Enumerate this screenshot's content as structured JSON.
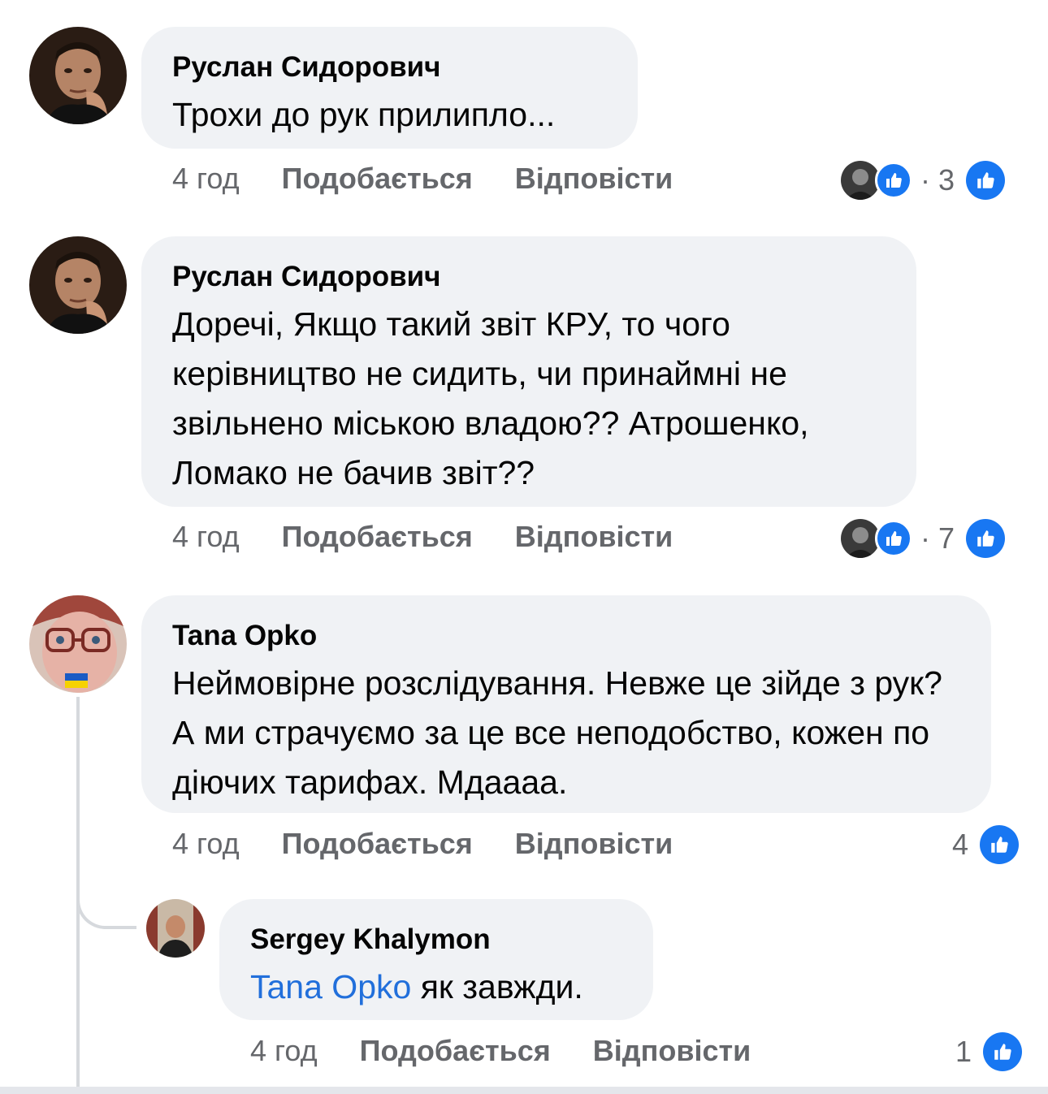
{
  "colors": {
    "bubble_bg": "#f0f2f5",
    "meta_text": "#65676b",
    "like_blue": "#1877f2",
    "mention_blue": "#216fdb"
  },
  "comments": [
    {
      "author": "Руслан Сидорович",
      "text": "Трохи до рук прилипло...",
      "time": "4 год",
      "like_label": "Подобається",
      "reply_label": "Відповісти",
      "reaction_separator": "·",
      "reaction_count": "3",
      "reaction_icons": [
        "reactor-avatar",
        "like-icon"
      ]
    },
    {
      "author": "Руслан Сидорович",
      "text": "Доречі, Якщо такий звіт КРУ, то чого керівництво не сидить, чи принаймні не звільнено міською владою?? Атрошенко, Ломако не бачив звіт??",
      "time": "4 год",
      "like_label": "Подобається",
      "reply_label": "Відповісти",
      "reaction_separator": "·",
      "reaction_count": "7",
      "reaction_icons": [
        "reactor-avatar",
        "like-icon"
      ]
    },
    {
      "author": "Tana  Opko",
      "text": "Неймовірне розслідування. Невже це зійде з рук? А ми страчуємо за це все неподобство, кожен по діючих тарифах. Мдаааа.",
      "time": "4 год",
      "like_label": "Подобається",
      "reply_label": "Відповісти",
      "reaction_count": "4"
    }
  ],
  "reply": {
    "author": "Sergey Khalymon",
    "mention": "Tana Opko",
    "text": " як завжди.",
    "time": "4 год",
    "like_label": "Подобається",
    "reply_label": "Відповісти",
    "reaction_count": "1"
  }
}
